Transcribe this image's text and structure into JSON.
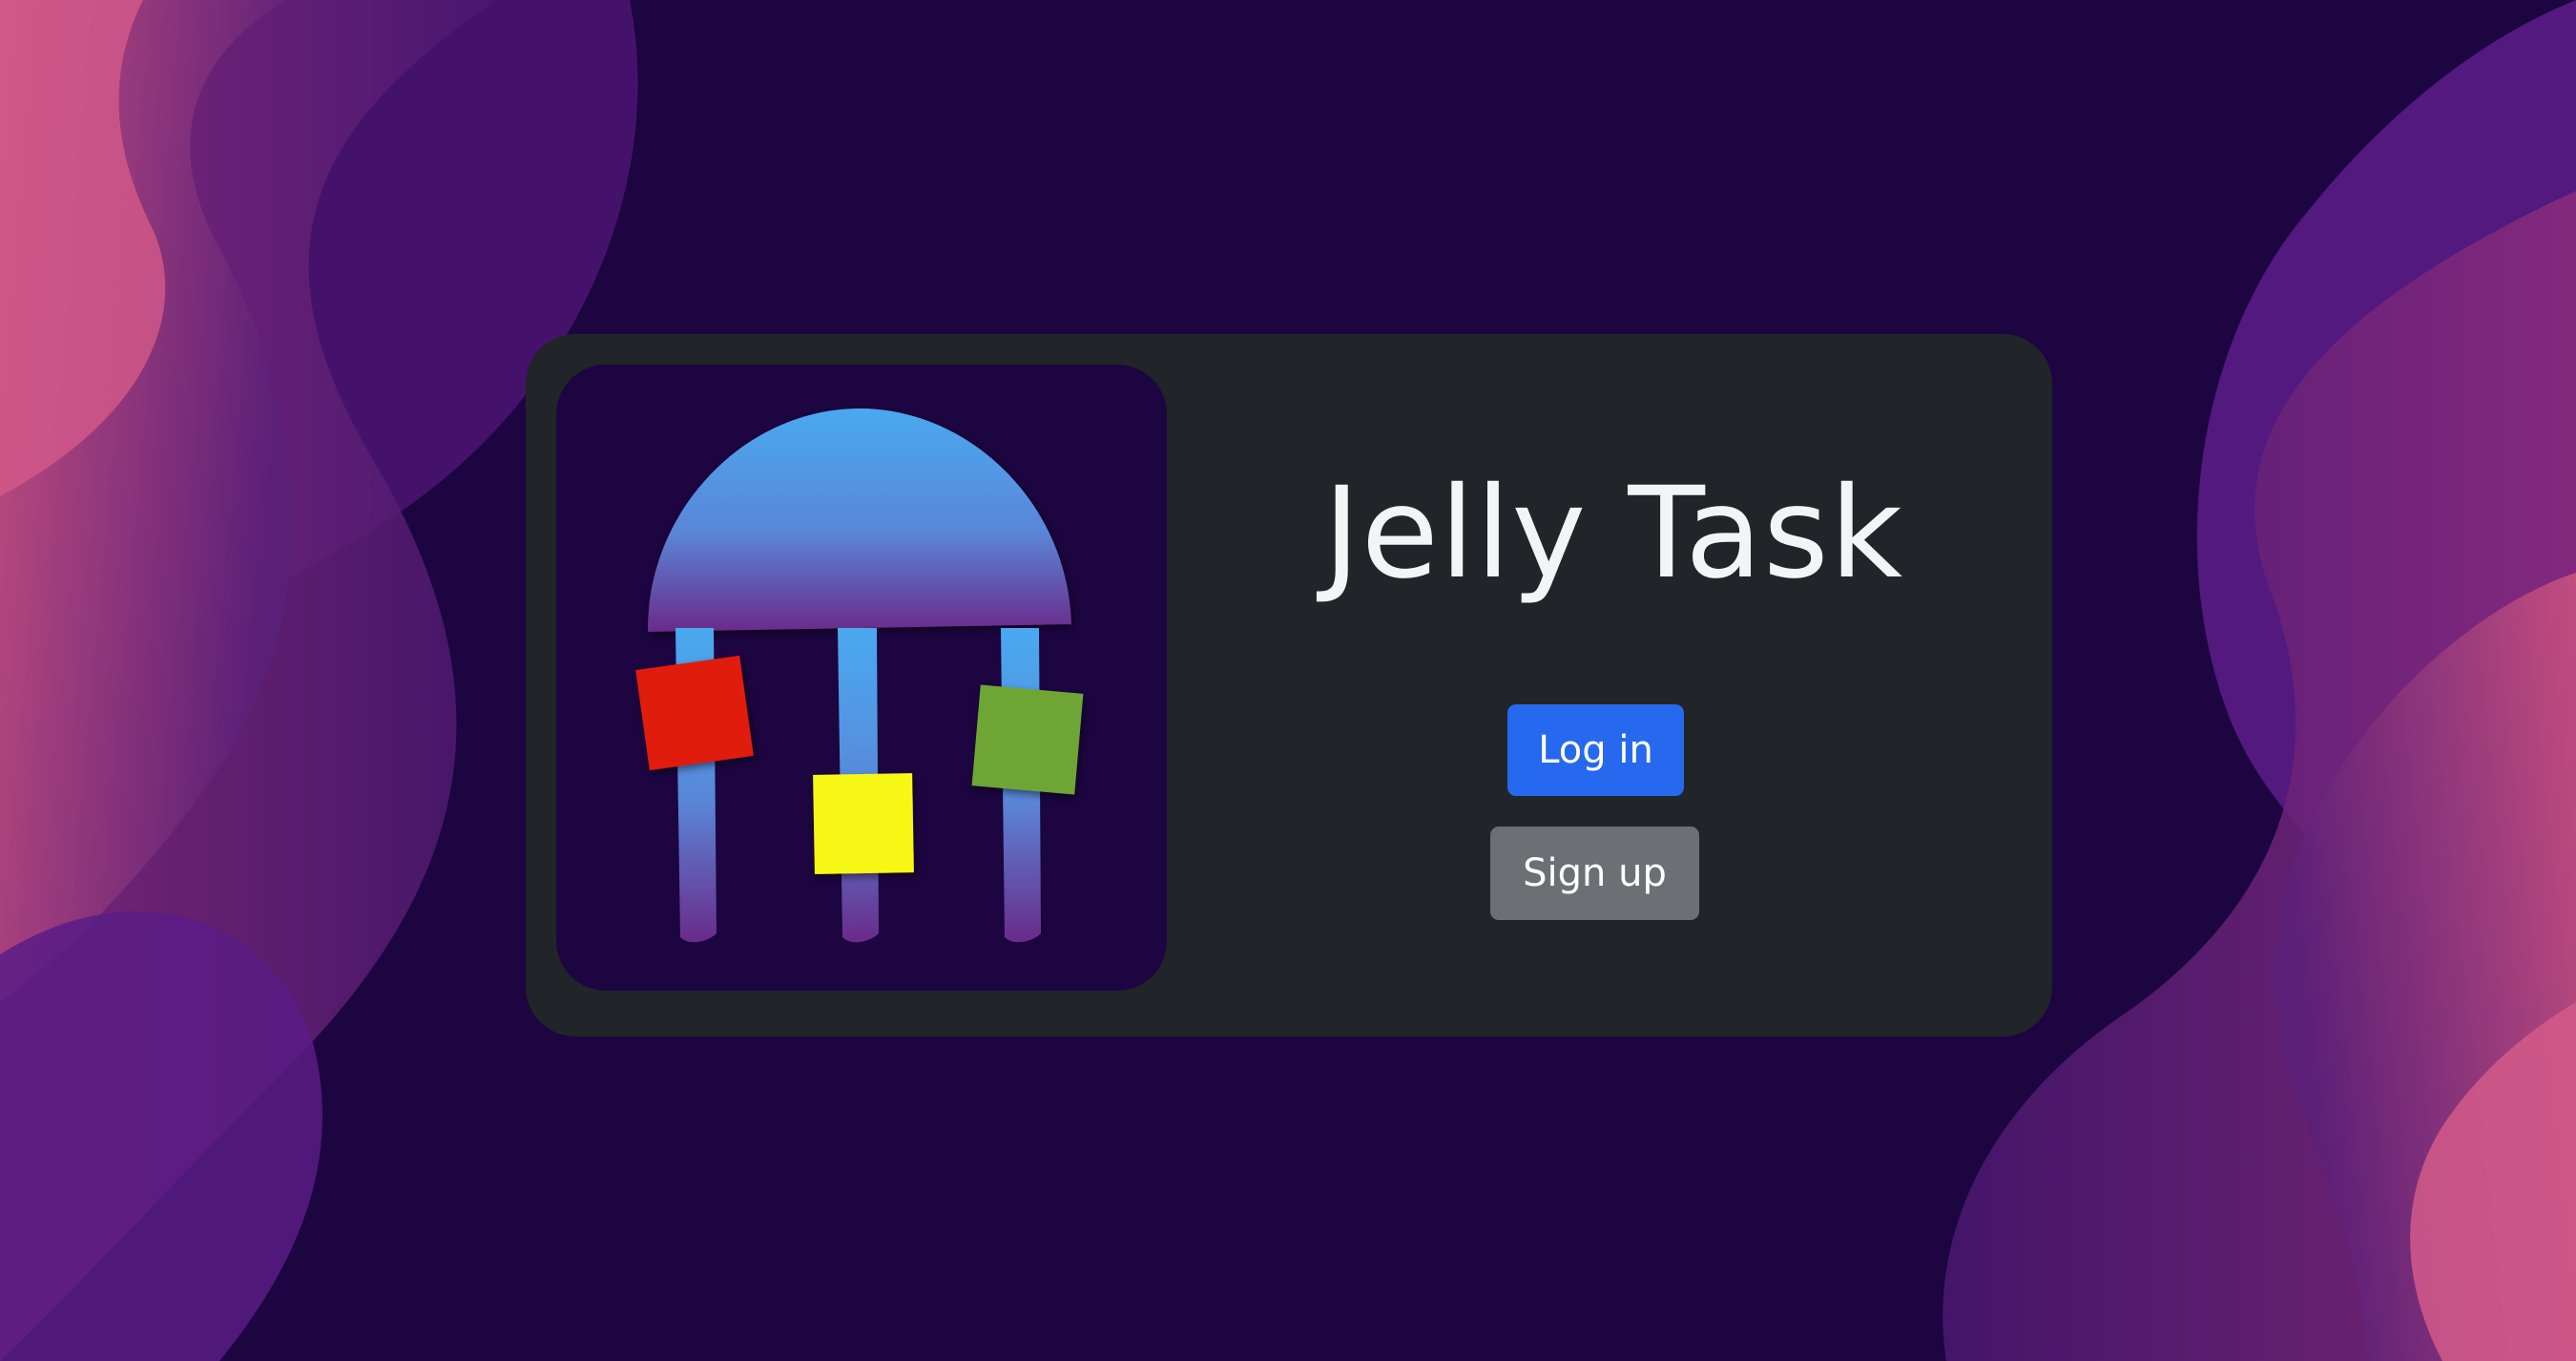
{
  "app": {
    "title": "Jelly Task",
    "logo_icon": "jellyfish-logo-icon"
  },
  "actions": {
    "login_label": "Log in",
    "signup_label": "Sign up"
  },
  "colors": {
    "background": "#1c0540",
    "card": "#212428",
    "login_button": "#2769ee",
    "signup_button": "#6c7075",
    "title_text": "#f3f4f6",
    "jelly_top": "#4aa9ef",
    "jelly_bottom": "#6a2a8a",
    "note_red": "#e01a0c",
    "note_yellow": "#f7f716",
    "note_green": "#6ea536"
  }
}
